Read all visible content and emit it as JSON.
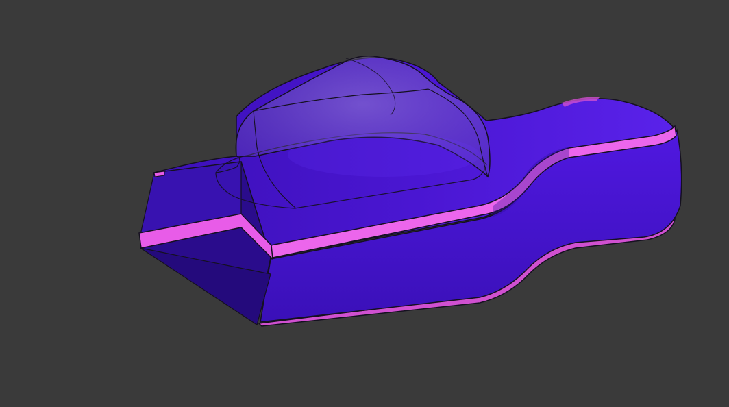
{
  "viewport": {
    "background": "#3a3a3a"
  },
  "model": {
    "body_color": "#4a14d6",
    "body_dark": "#2c0c96",
    "body_light": "#5a22f0",
    "stripe_color": "#e85ce8",
    "edge_color": "#151020",
    "canopy_fill": "#8a7cb8",
    "canopy_opacity": 0.35
  }
}
